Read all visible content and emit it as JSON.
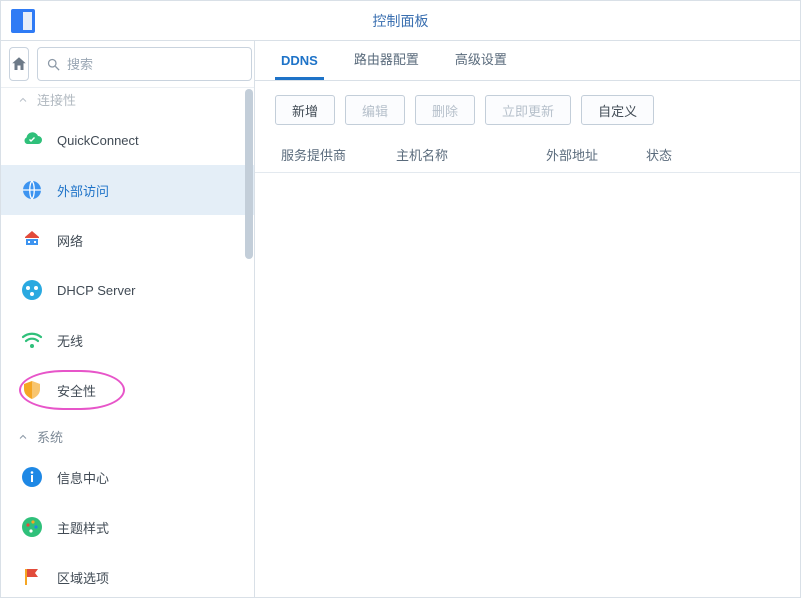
{
  "window": {
    "title": "控制面板"
  },
  "search": {
    "placeholder": "搜索"
  },
  "sidebar": {
    "truncated_section_label": "连接性",
    "items": [
      {
        "label": "QuickConnect"
      },
      {
        "label": "外部访问"
      },
      {
        "label": "网络"
      },
      {
        "label": "DHCP Server"
      },
      {
        "label": "无线"
      },
      {
        "label": "安全性"
      }
    ],
    "system_section": {
      "label": "系统",
      "items": [
        {
          "label": "信息中心"
        },
        {
          "label": "主题样式"
        },
        {
          "label": "区域选项"
        }
      ]
    }
  },
  "tabs": [
    {
      "label": "DDNS",
      "active": true
    },
    {
      "label": "路由器配置",
      "active": false
    },
    {
      "label": "高级设置",
      "active": false
    }
  ],
  "toolbar": {
    "add": "新增",
    "edit": "编辑",
    "delete": "删除",
    "update_now": "立即更新",
    "custom": "自定义"
  },
  "table": {
    "columns": [
      "服务提供商",
      "主机名称",
      "外部地址",
      "状态"
    ],
    "rows": []
  },
  "colors": {
    "accent": "#1e73c8",
    "highlight_ring": "#e755c9"
  }
}
